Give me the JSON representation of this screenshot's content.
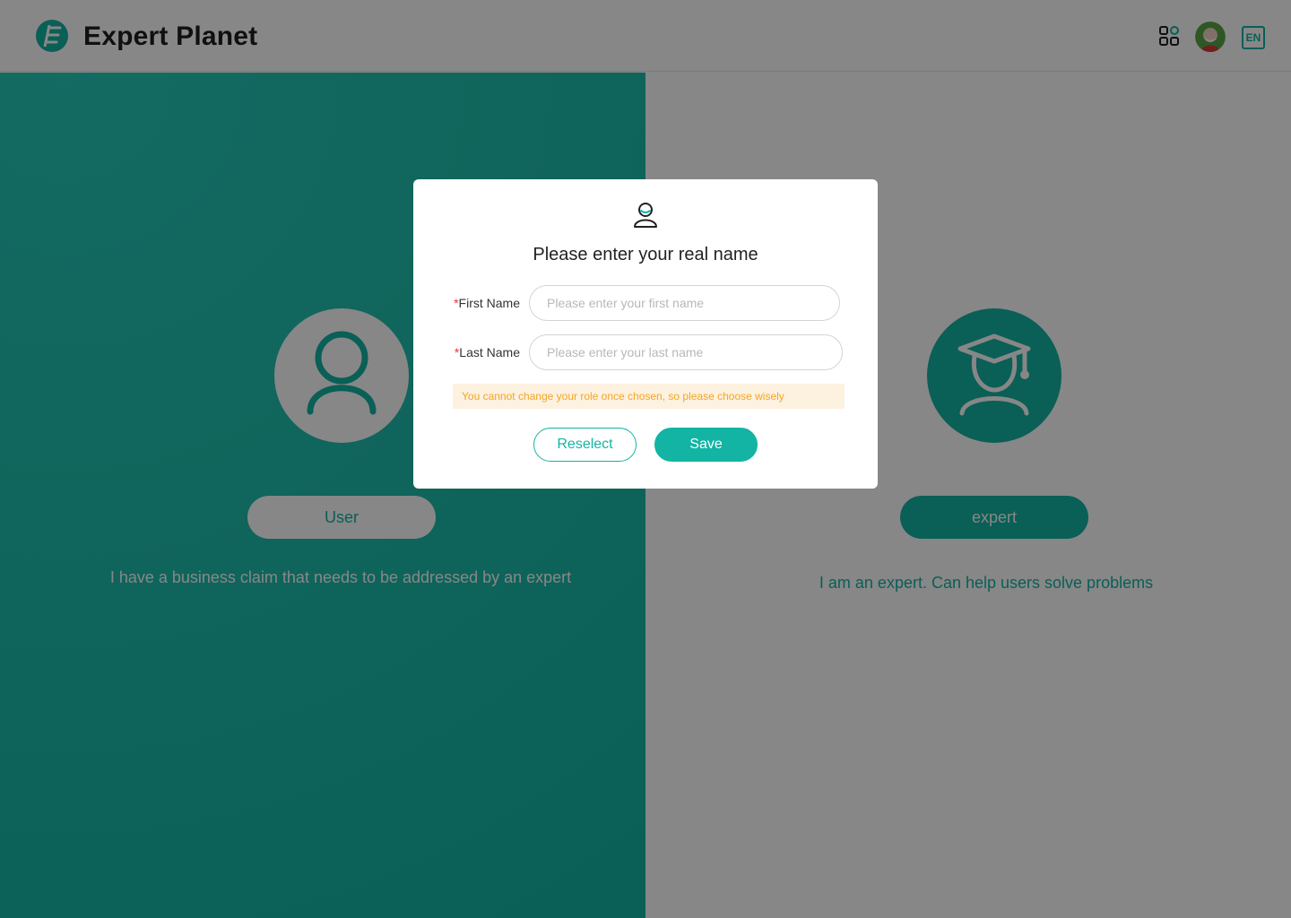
{
  "header": {
    "logo_text": "Expert Planet",
    "language": "EN",
    "icons": [
      "logo-icon",
      "apps-grid-icon",
      "avatar",
      "language-icon"
    ]
  },
  "roles": {
    "user": {
      "button_label": "User",
      "description": "I have a business claim that needs to be addressed by an expert",
      "icon": "user-icon"
    },
    "expert": {
      "button_label": "expert",
      "description": "I am an expert. Can help users solve problems",
      "icon": "graduate-icon"
    }
  },
  "dialog": {
    "title": "Please enter your real name",
    "icon": "person-icon",
    "first_name": {
      "required_mark": "*",
      "label": "First Name",
      "placeholder": "Please enter your first name",
      "value": ""
    },
    "last_name": {
      "required_mark": "*",
      "label": "Last Name",
      "placeholder": "Please enter your last name",
      "value": ""
    },
    "warning": "You cannot change your role once chosen, so please choose wisely",
    "reselect_label": "Reselect",
    "save_label": "Save"
  },
  "colors": {
    "brand": "#13b4a3",
    "warning_text": "#f5a623",
    "warning_bg": "#fdf1e0",
    "required": "#f33131"
  }
}
